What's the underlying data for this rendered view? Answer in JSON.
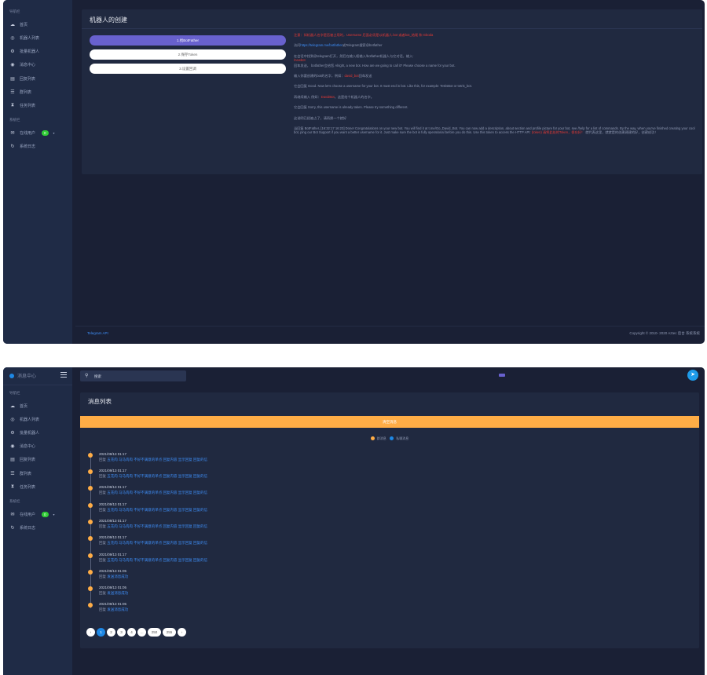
{
  "shot1": {
    "sidebar": {
      "section1": "导航栏",
      "items": [
        {
          "icon": "cloud-icon",
          "label": "首页"
        },
        {
          "icon": "robot-icon",
          "label": "机器人列表"
        },
        {
          "icon": "cogs-icon",
          "label": "批量机器人"
        },
        {
          "icon": "message-icon",
          "label": "消息中心"
        },
        {
          "icon": "keyboard-icon",
          "label": "回复列表"
        },
        {
          "icon": "database-icon",
          "label": "群列表"
        },
        {
          "icon": "hourglass-icon",
          "label": "任务列表"
        }
      ],
      "section2": "系统栏",
      "items2": [
        {
          "icon": "chat-icon",
          "label": "在线用户",
          "badge": "0"
        },
        {
          "icon": "refresh-icon",
          "label": "系统日志"
        }
      ]
    },
    "card": {
      "title": "机器人的创建",
      "tabs": [
        "1.找BotFather",
        "2.保存Token",
        "3.设置回调"
      ],
      "steps": [
        {
          "red": "注意：如机器人名字是否被占用时，Username 后面必须是以机器人.bot 或者bot_结尾 和 Gboda",
          "blue": "",
          "rest": ""
        },
        {
          "pre": "访问",
          "blue": "https://telegram.me/botfather",
          "rest": "或Telegram搜索@botfather"
        },
        {
          "pre": "打开",
          "blue": "",
          "rest": "在会话中找到@telegram打开，然后在输入框输入/botfather机器人与它对话，输入:",
          "red": "/newbot"
        },
        {
          "pre": "",
          "blue": "",
          "rest": "回车发送，  botfather会给您 Alright, a new bot. How are we going to call it? Please choose a name for your bot."
        },
        {
          "pre": "输入你要创建的bot的名字，例如：",
          "red": "david_bot",
          "rest": "回车发送"
        },
        {
          "pre": "",
          "blue": "",
          "rest": "它会回复 Good. Now let's choose a username for your bot. It must end in bot. Like this, for example: TetrisBot or tetris_bot."
        },
        {
          "pre": "再继续输入 例如：",
          "red": "DavidBot",
          "rest": "，这是给个机器人的名字。"
        },
        {
          "pre": "",
          "blue": "",
          "rest": "它会回复 Sorry, this username is already taken. Please try something different."
        },
        {
          "pre": "",
          "blue": "",
          "rest": "这说明已经被占了，请再换一个就好"
        },
        {
          "pre": "",
          "blue": "",
          "rest": "当回复 BotFather, [16:32:17 16:23] Done! Congratulations on your new bot. You will find it at t.me/Go_David_Bot. You can now add a description, about section and profile picture for your bot, see /help for a list of commands. By the way, when you've finished creating your cool bot, ping our Bot Support if you want a better username for it. Just make sure the bot is fully operational before you do this. Use this token to access the HTTP API:",
          "red": "(token) 请将此处的Token，保存好！",
          "rest2": "就代表这里，就就是的创建建建的好，创建成功！"
        }
      ]
    },
    "footer": {
      "left": "Telegram API",
      "right": "Copyright © 2010- 2020 Aztec 后台 系统系统"
    }
  },
  "shot2": {
    "brand": "消息中心",
    "search": {
      "placeholder": "搜索"
    },
    "card": {
      "title": "消息列表",
      "banner": "清空消息",
      "legend": [
        {
          "color": "#ffad46",
          "label": "群消息"
        },
        {
          "color": "#1e88e5",
          "label": "私聊消息"
        }
      ],
      "entries": [
        {
          "time": "2021/09/13 01:17",
          "prefix": "回复",
          "text": "五花肉 马马肉肉 不好不满意的单点 回复内容 显示回复 回复的信"
        },
        {
          "time": "2021/09/13 01:17",
          "prefix": "回复",
          "text": "五花肉 马马肉肉 不好不满意的单点 回复内容 显示回复 回复的信"
        },
        {
          "time": "2021/09/13 01:17",
          "prefix": "回复",
          "text": "五花肉 马马肉肉 不好不满意的单点 回复内容 显示回复 回复的信"
        },
        {
          "time": "2021/09/13 01:17",
          "prefix": "回复",
          "text": "五花肉 马马肉肉 不好不满意的单点 回复内容 显示回复 回复的信"
        },
        {
          "time": "2021/09/13 01:17",
          "prefix": "回复",
          "text": "五花肉 马马肉肉 不好不满意的单点 回复内容 显示回复 回复的信"
        },
        {
          "time": "2021/09/13 01:17",
          "prefix": "回复",
          "text": "五花肉 马马肉肉 不好不满意的单点 回复内容 显示回复 回复的信"
        },
        {
          "time": "2021/09/13 01:17",
          "prefix": "回复",
          "text": "五花肉 马马肉肉 不好不满意的单点 回复内容 显示回复 回复的信"
        },
        {
          "time": "2021/09/13 01:05",
          "prefix": "回复",
          "text": "发送消息成功"
        },
        {
          "time": "2021/09/13 01:05",
          "prefix": "回复",
          "text": "发送消息成功"
        },
        {
          "time": "2021/09/13 01:05",
          "prefix": "回复",
          "text": "发送消息成功"
        }
      ],
      "pager": [
        "‹",
        "1",
        "2",
        "3",
        "4",
        "…",
        "250",
        "255",
        "›"
      ]
    }
  }
}
